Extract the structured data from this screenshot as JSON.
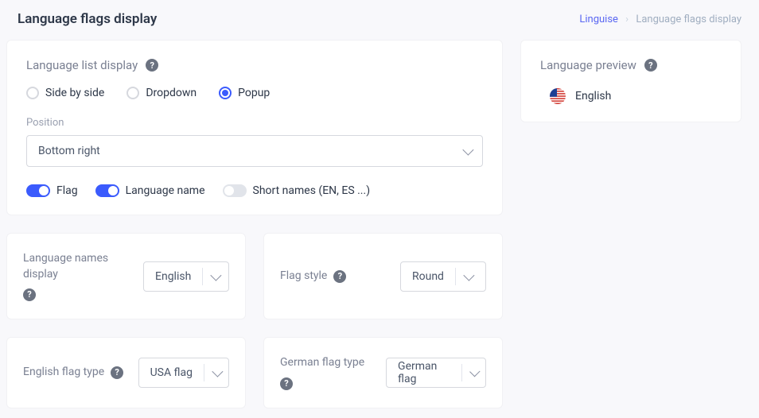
{
  "header": {
    "title": "Language flags display",
    "breadcrumb": {
      "root": "Linguise",
      "current": "Language flags display"
    }
  },
  "list_display": {
    "heading": "Language list display",
    "options": {
      "side_by_side": "Side by side",
      "dropdown": "Dropdown",
      "popup": "Popup"
    },
    "position_label": "Position",
    "position_value": "Bottom right",
    "toggles": {
      "flag": "Flag",
      "language_name": "Language name",
      "short_names": "Short names (EN, ES ...)"
    }
  },
  "names_display": {
    "label": "Language names display",
    "value": "English"
  },
  "flag_style": {
    "label": "Flag style",
    "value": "Round"
  },
  "english_flag": {
    "label": "English flag type",
    "value": "USA flag"
  },
  "german_flag": {
    "label": "German flag type",
    "value": "German flag"
  },
  "preview": {
    "heading": "Language preview",
    "language": "English"
  }
}
